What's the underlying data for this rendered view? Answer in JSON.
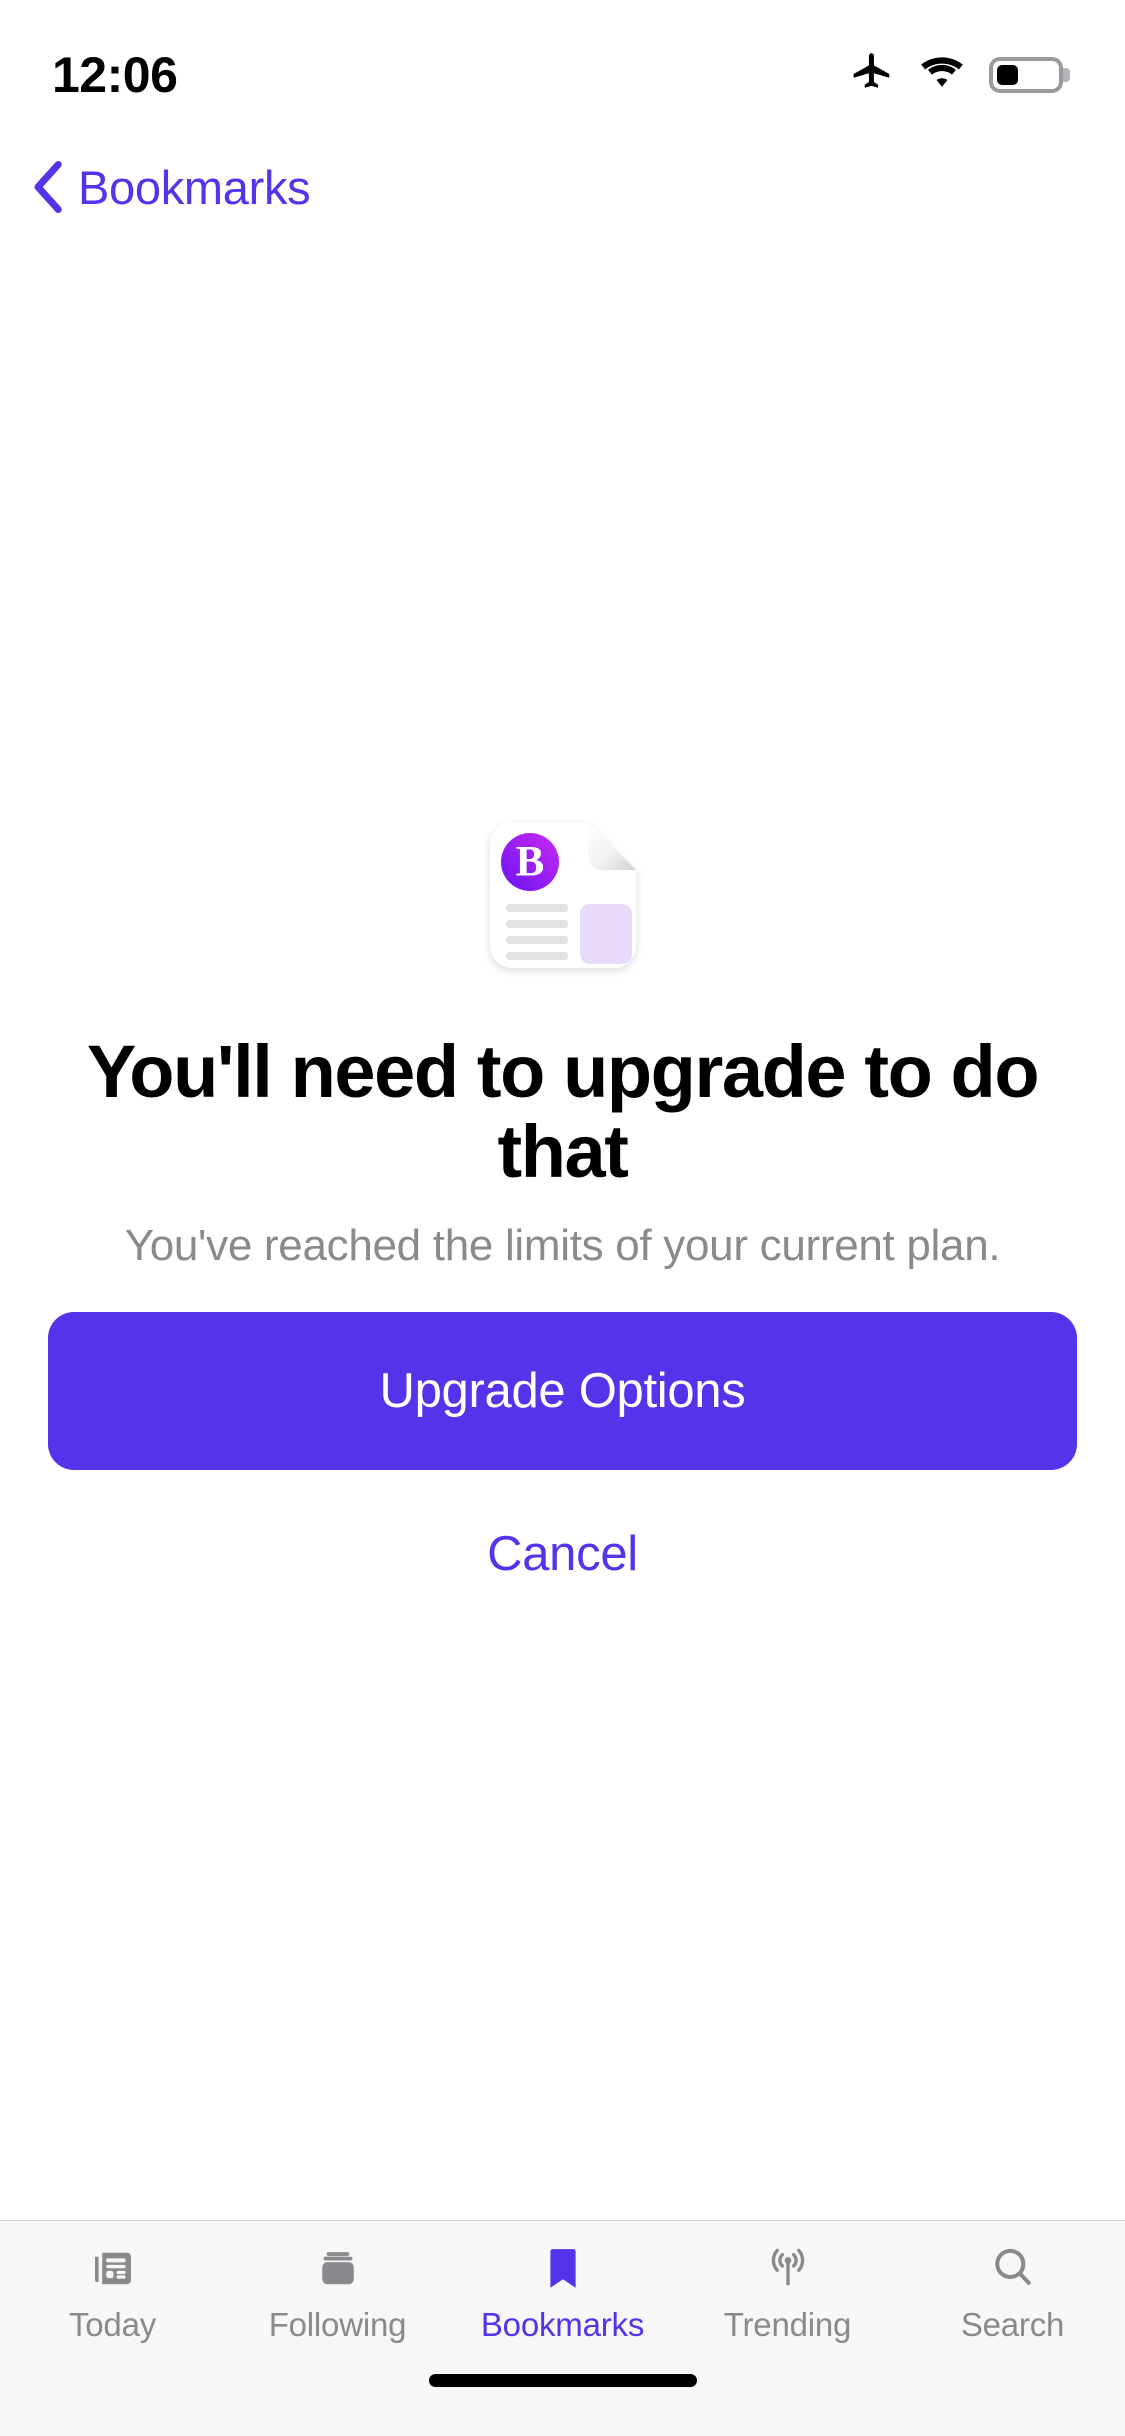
{
  "status_bar": {
    "time": "12:06",
    "icons": [
      "airplane-mode-icon",
      "wifi-icon",
      "battery-icon"
    ],
    "battery_level_percent": 36
  },
  "nav_bar": {
    "back_label": "Bookmarks",
    "back_icon": "chevron-left-icon",
    "accent_color": "#5433EB"
  },
  "main": {
    "hero_icon": "article-document-app-icon",
    "headline": "You'll need to upgrade to do that",
    "subtitle": "You've reached the limits of your current plan.",
    "primary_button_label": "Upgrade Options",
    "cancel_button_label": "Cancel",
    "primary_button_color": "#5433EB",
    "subtitle_color": "#8a8a8e"
  },
  "tab_bar": {
    "active_tab": "Bookmarks",
    "inactive_color": "#8a8a8e",
    "active_color": "#5433EB",
    "items": [
      {
        "label": "Today",
        "icon": "newspaper-icon"
      },
      {
        "label": "Following",
        "icon": "stacked-cards-icon"
      },
      {
        "label": "Bookmarks",
        "icon": "bookmark-icon"
      },
      {
        "label": "Trending",
        "icon": "broadcast-icon"
      },
      {
        "label": "Search",
        "icon": "magnifying-glass-icon"
      }
    ]
  }
}
